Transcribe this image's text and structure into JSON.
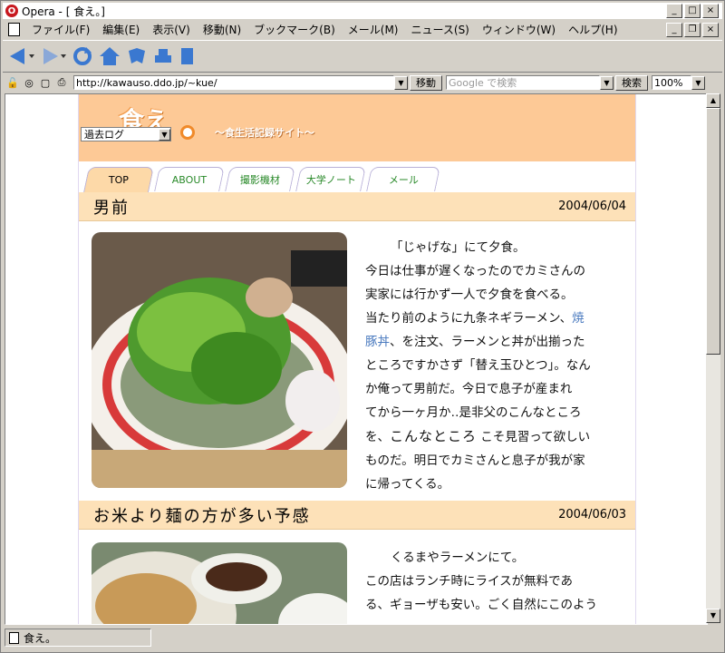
{
  "window": {
    "title": "Opera - [ 食え。]"
  },
  "menu": [
    "ファイル(F)",
    "編集(E)",
    "表示(V)",
    "移動(N)",
    "ブックマーク(B)",
    "メール(M)",
    "ニュース(S)",
    "ウィンドウ(W)",
    "ヘルプ(H)"
  ],
  "address": {
    "url": "http://kawauso.ddo.jp/~kue/",
    "go_label": "移動",
    "search_placeholder": "Google で検索",
    "search_label": "検索",
    "zoom": "100%"
  },
  "site": {
    "logo": "食え",
    "tagline": "〜食生活記録サイト〜",
    "archive_label": "過去ログ"
  },
  "tabs": [
    "TOP",
    "ABOUT",
    "撮影機材",
    "大学ノート",
    "メール"
  ],
  "posts": [
    {
      "title": "男前",
      "date": "2004/06/04",
      "lines": [
        "「じゃげな」にて夕食。",
        "今日は仕事が遅くなったのでカミさんの",
        "実家には行かず一人で夕食を食べる。",
        "当たり前のように九条ネギラーメン、",
        "焼",
        "豚丼",
        "、を注文、ラーメンと丼が出揃った",
        "ところですかさず「替え玉ひとつ」。なん",
        "か俺って男前だ。今日で息子が産まれ",
        "てから一ヶ月か‥是非父のこんなところ",
        "を、",
        "こんなところ",
        " こそ見習って欲しい",
        "ものだ。明日でカミさんと息子が我が家",
        "に帰ってくる。"
      ]
    },
    {
      "title": "お米より麺の方が多い予感",
      "date": "2004/06/03",
      "lines": [
        "くるまやラーメンにて。",
        "この店はランチ時にライスが無料であ",
        "る、ギョーザも安い。ごく自然にこのよう"
      ]
    }
  ],
  "status": {
    "text": "食え。"
  }
}
